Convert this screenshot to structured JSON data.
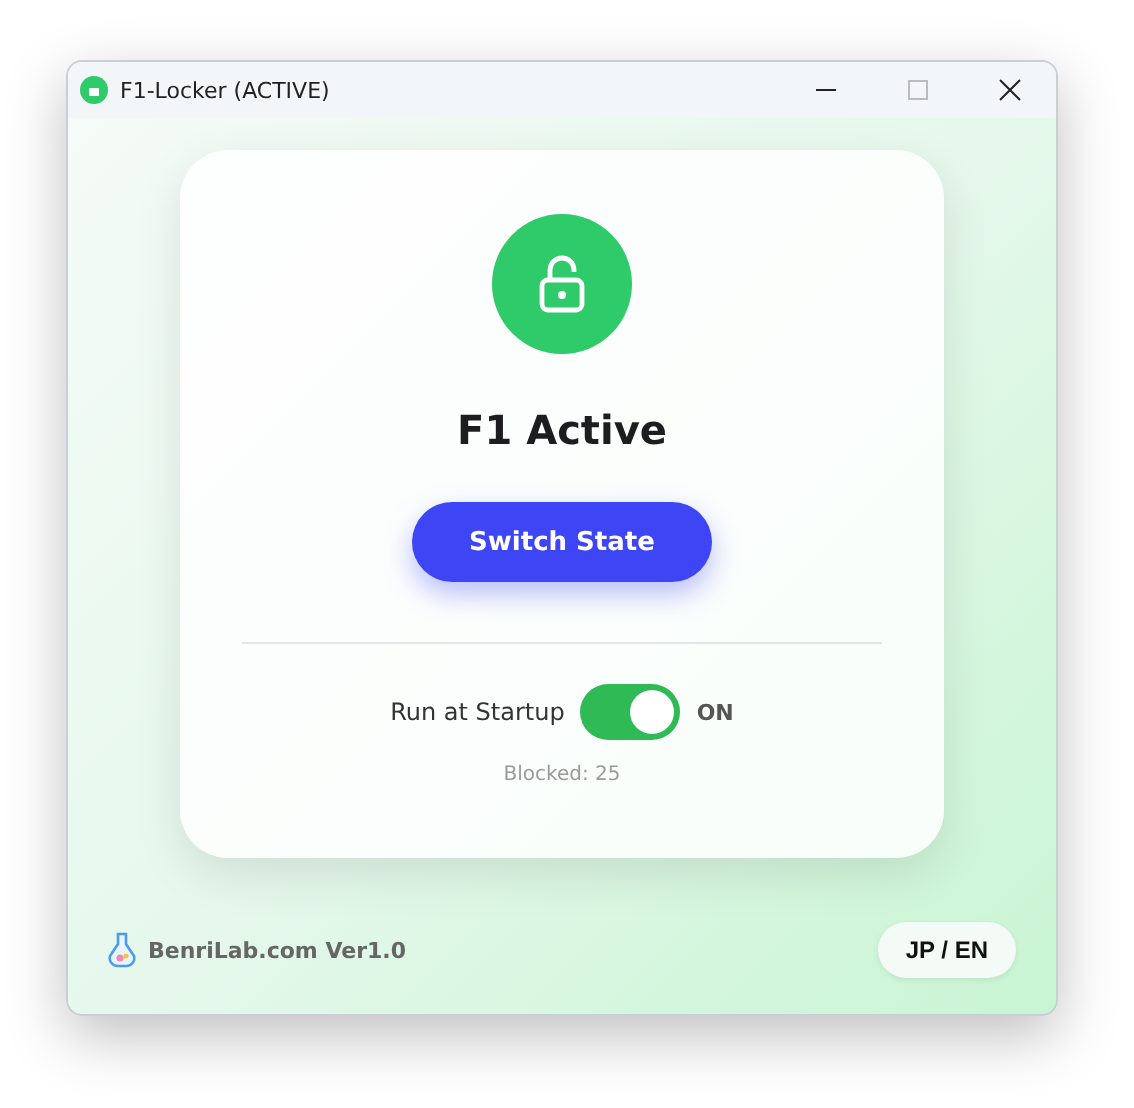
{
  "window": {
    "title": "F1-Locker (ACTIVE)"
  },
  "status": {
    "title": "F1 Active",
    "locked": false
  },
  "switch_button": {
    "label": "Switch State"
  },
  "startup": {
    "label": "Run at Startup",
    "on": true,
    "state_text": "ON"
  },
  "blocked": "Blocked: 25",
  "footer": {
    "brand": "BenriLab.com Ver1.0",
    "language_button": "JP / EN"
  }
}
